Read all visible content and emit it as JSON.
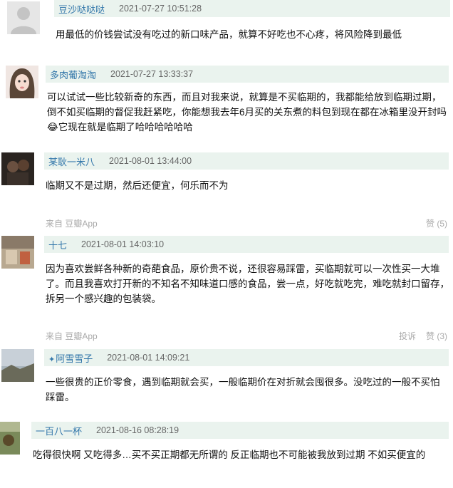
{
  "comments": [
    {
      "name": "豆沙哒哒哒",
      "time": "2021-07-27 10:51:28",
      "text": "用最低的价钱尝试没有吃过的新口味产品，就算不好吃也不心疼，将风险降到最低"
    },
    {
      "name": "多肉葡淘淘",
      "time": "2021-07-27 13:33:37",
      "text": "可以试试一些比较新奇的东西，而且对我来说，就算是不买临期的，我都能给放到临期过期，倒不如买临期的督促我赶紧吃，你能想我去年6月买的关东煮的料包到现在都在冰箱里没开封吗😂它现在就是临期了哈哈哈哈哈哈"
    },
    {
      "name": "某耿一米八",
      "time": "2021-08-01 13:44:00",
      "text": "临期又不是过期，然后还便宜，何乐而不为",
      "source": "来自 豆瓣App",
      "like": "赞 (5)"
    },
    {
      "name": "十七",
      "time": "2021-08-01 14:03:10",
      "text": "因为喜欢尝鲜各种新的奇葩食品，原价贵不说，还很容易踩雷，买临期就可以一次性买一大堆了。而且我喜欢打开新的不知名不知味道口感的食品，尝一点，好吃就吃完，难吃就封口留存，拆另一个感兴趣的包装袋。",
      "source": "来自 豆瓣App",
      "report": "投诉",
      "like": "赞 (3)"
    },
    {
      "name": "阿雪雪子",
      "vip": "✦",
      "time": "2021-08-01 14:09:21",
      "text": "一些很贵的正价零食，遇到临期就会买，一般临期价在对折就会囤很多。没吃过的一般不买怕踩雷。"
    },
    {
      "name": "一百八一杯",
      "time": "2021-08-16 08:28:19",
      "text": "吃得很快啊 又吃得多…买不买正期都无所谓的 反正临期也不可能被我放到过期 不如买便宜的"
    }
  ]
}
